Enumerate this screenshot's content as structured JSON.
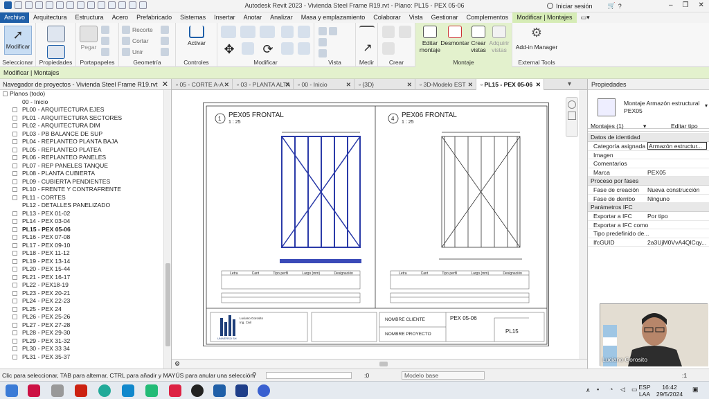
{
  "window": {
    "title": "Autodesk Revit 2023 - Vivienda Steel Frame R19.rvt - Plano: PL15 - PEX 05-06",
    "signin": "Iniciar sesión"
  },
  "menu": [
    "Archivo",
    "Arquitectura",
    "Estructura",
    "Acero",
    "Prefabricado",
    "Sistemas",
    "Insertar",
    "Anotar",
    "Analizar",
    "Masa y emplazamiento",
    "Colaborar",
    "Vista",
    "Gestionar",
    "Complementos",
    "Modificar | Montajes"
  ],
  "ribbon": {
    "modify": "Modificar",
    "paste": "Pegar",
    "cut": "Cortar",
    "unite": "Unir",
    "recorte": "Recorte",
    "activate": "Activar",
    "edit_assembly": "Editar montaje",
    "disassemble": "Desmontar",
    "create_views": "Crear vistas",
    "acquire_views": "Adquirir vistas",
    "addin_manager": "Add-in Manager",
    "groups": [
      "Seleccionar",
      "Propiedades",
      "Portapapeles",
      "Geometría",
      "Controles",
      "Modificar",
      "Vista",
      "Medir",
      "Crear",
      "Montaje",
      "External Tools"
    ]
  },
  "context_bar": "Modificar | Montajes",
  "browser": {
    "title": "Navegador de proyectos - Vivienda Steel Frame R19.rvt",
    "root": "Planos (todo)",
    "items": [
      "00 - Inicio",
      "PL00 - ARQUITECTURA EJES",
      "PL01 - ARQUITECTURA SECTORES",
      "PL02 - ARQUITECTURA DIM",
      "PL03 - PB BALANCE DE SUP",
      "PL04 - REPLANTEO PLANTA BAJA",
      "PL05 - REPLANTEO PLATEA",
      "PL06 - REPLANTEO PANELES",
      "PL07 - REP PANELES TANQUE",
      "PL08 - PLANTA CUBIERTA",
      "PL09 - CUBIERTA PENDIENTES",
      "PL10 - FRENTE Y CONTRAFRENTE",
      "PL11 - CORTES",
      "PL12 - DETALLES PANELIZADO",
      "PL13 - PEX 01-02",
      "PL14 - PEX 03-04",
      "PL15 - PEX 05-06",
      "PL16 - PEX 07-08",
      "PL17 - PEX 09-10",
      "PL18 - PEX 11-12",
      "PL19 - PEX 13-14",
      "PL20 - PEX 15-44",
      "PL21 - PEX 16-17",
      "PL22 - PEX18-19",
      "PL23 - PEX 20-21",
      "PL24 - PEX 22-23",
      "PL25 - PEX 24",
      "PL26 - PEX 25-26",
      "PL27 - PEX 27-28",
      "PL28 - PEX 29-30",
      "PL29 - PEX 31-32",
      "PL30 - PEX 33 34",
      "PL31 - PEX 35-37"
    ],
    "selected_index": 16,
    "no_expander": [
      0,
      13
    ]
  },
  "view_tabs": [
    "05 - CORTE A-A",
    "03 - PLANTA ALTA",
    "00 - Inicio",
    "{3D}",
    "3D-Modelo EST",
    "PL15 - PEX 05-06"
  ],
  "active_tab": 5,
  "sheet": {
    "view1": {
      "num": "1",
      "title": "PEX05 FRONTAL",
      "scale": "1 : 25"
    },
    "view2": {
      "num": "4",
      "title": "PEX06 FRONTAL",
      "scale": "1 : 25"
    },
    "table_headers": [
      "Letra",
      "Cant",
      "Tipo perfil",
      "Largo (mm)",
      "Designación"
    ],
    "client_label": "NOMBRE CLIENTE",
    "project_label": "NOMBRE PROYECTO",
    "sheet_name": "PEX 05-06",
    "sheet_number": "PL15",
    "company": "UNIVERSO SH",
    "engineer": "Luciano Gorosito",
    "engineer_role": "Ing. Civil"
  },
  "properties": {
    "title": "Propiedades",
    "type_name": "Montaje Armazón estructural PEX05",
    "filter": "Montajes (1)",
    "edit_type": "Editar tipo",
    "sections": [
      {
        "name": "Datos de identidad",
        "rows": [
          [
            "Categoría asignada",
            "Armazón estructur..."
          ],
          [
            "Imagen",
            ""
          ],
          [
            "Comentarios",
            ""
          ],
          [
            "Marca",
            "PEX05"
          ]
        ]
      },
      {
        "name": "Proceso por fases",
        "rows": [
          [
            "Fase de creación",
            "Nueva construcción"
          ],
          [
            "Fase de derribo",
            "Ninguno"
          ]
        ]
      },
      {
        "name": "Parámetros IFC",
        "rows": [
          [
            "Exportar a IFC",
            "Por tipo"
          ],
          [
            "Exportar a IFC como",
            ""
          ],
          [
            "Tipo predefinido de...",
            ""
          ],
          [
            "IfcGUID",
            "2a3UjM0VvA4QlCqy..."
          ]
        ]
      }
    ],
    "help_link": "Ayuda de propiedades"
  },
  "video": {
    "name": "Luciano Gorosito"
  },
  "status": {
    "text": "Clic para seleccionar, TAB para alternar, CTRL para añadir y MAYÚS para anular una selección.",
    "model": "Modelo base",
    "counter": ":0",
    "filter_count": ":1"
  },
  "taskbar": {
    "lang": "ESP",
    "lang2": "LAA",
    "time": "16:42",
    "date": "29/5/2024"
  }
}
